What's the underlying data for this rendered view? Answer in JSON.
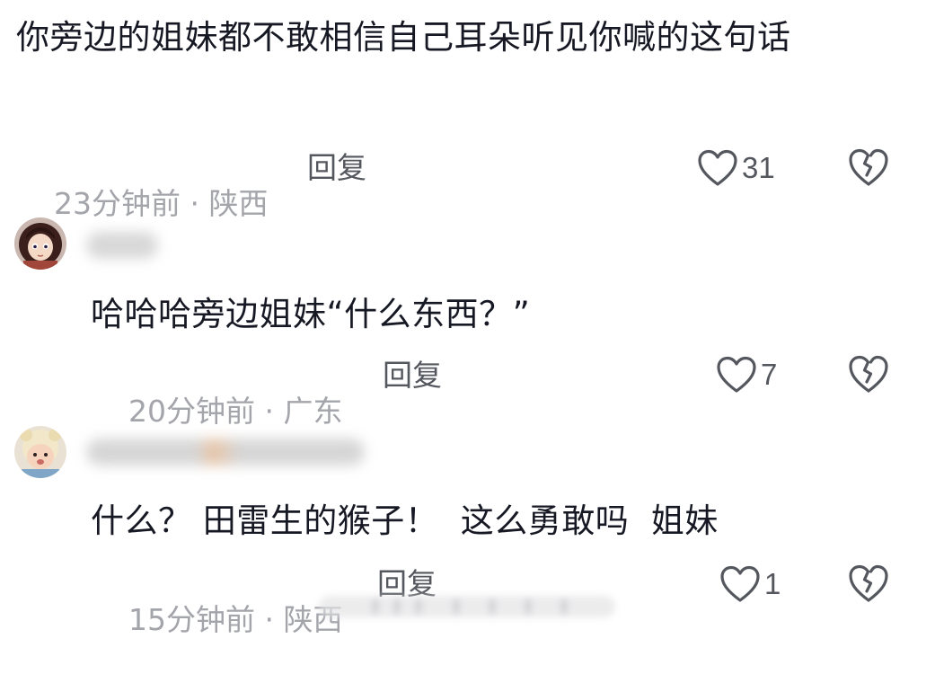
{
  "comments": [
    {
      "text": "你旁边的姐妹都不敢相信自己耳朵听见你喊的这句话",
      "time": "23分钟前",
      "location": "陕西",
      "reply_label": "回复",
      "likes": "31",
      "username": ""
    },
    {
      "text": "哈哈哈旁边姐妹“什么东西？”",
      "time": "20分钟前",
      "location": "广东",
      "reply_label": "回复",
      "likes": "7",
      "username": ""
    },
    {
      "text": "什么？ 田雷生的猴子！  这么勇敢吗  姐妹",
      "time": "15分钟前",
      "location": "陕西",
      "reply_label": "回复",
      "likes": "1",
      "username": ""
    }
  ],
  "icons": {
    "like": "heart-outline-icon",
    "dislike": "broken-heart-icon"
  },
  "colors": {
    "text": "#161823",
    "meta": "#a3a5ab",
    "action": "#54575e"
  }
}
